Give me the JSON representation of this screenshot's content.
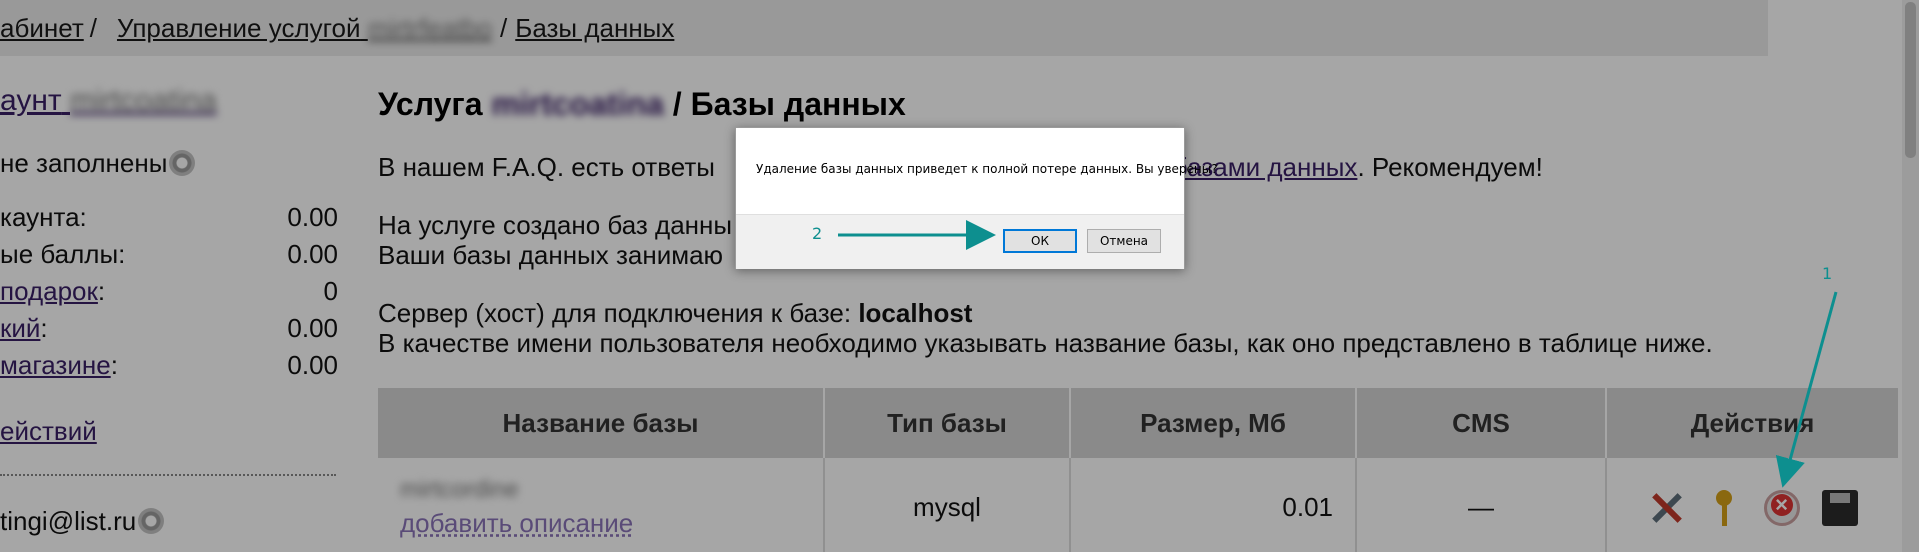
{
  "breadcrumb": {
    "item1": "абинет",
    "item2_prefix": "Управление услугой",
    "item2_blurred": "mirtrfeatbo",
    "item3": "Базы данных"
  },
  "sidebar": {
    "account_prefix": "аунт",
    "account_blurred": "mirtcoatina",
    "not_filled": "не заполнены",
    "stats": [
      {
        "label": "каунта:",
        "value": "0.00"
      },
      {
        "label": "ые баллы:",
        "value": "0.00"
      },
      {
        "label": "подарок",
        "suffix": ":",
        "value": "0"
      },
      {
        "label": "кий",
        "suffix": ":",
        "value": "0.00"
      },
      {
        "label": "магазине",
        "suffix": ":",
        "value": "0.00"
      }
    ],
    "actions_link": "ействий",
    "email": "tingi@list.ru"
  },
  "main": {
    "title_prefix": "Услуга",
    "title_blurred": "mirtcoatina",
    "title_suffix": "/ Базы данных",
    "faq_text_start": "В нашем F.A.Q. есть ответы",
    "faq_link": "базами данных",
    "faq_text_end": ". Рекомендуем!",
    "count_line": "На услуге создано баз данны",
    "usage_line": "Ваши базы данных занимаю",
    "server_label": "Сервер (хост) для подключения к базе:",
    "server_value": "localhost",
    "username_hint": "В качестве имени пользователя необходимо указывать название базы, как оно представлено в таблице ниже."
  },
  "table": {
    "headers": [
      "Название базы",
      "Тип базы",
      "Размер, Мб",
      "CMS",
      "Действия"
    ],
    "rows": [
      {
        "name_blurred": "mirtcordine",
        "add_desc": "добавить описание",
        "type": "mysql",
        "size": "0.01",
        "cms": "—"
      }
    ],
    "action_icons": [
      "tools-icon",
      "key-icon",
      "delete-icon",
      "save-icon"
    ]
  },
  "dialog": {
    "message": "Удаление базы данных приведет к полной потере данных. Вы уверены?",
    "ok_label": "ОК",
    "cancel_label": "Отмена"
  },
  "annotations": {
    "label1": "1",
    "label2": "2",
    "color": "#0d8f8f"
  }
}
